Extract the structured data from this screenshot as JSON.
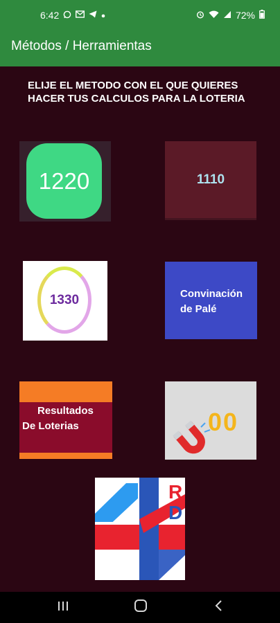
{
  "status_bar": {
    "time": "6:42",
    "left_icons": [
      "whatsapp-icon",
      "gmail-icon",
      "telegram-icon",
      "notification-dot-icon"
    ],
    "right_icons": [
      "alarm-icon",
      "wifi-icon",
      "signal-icon",
      "battery-icon"
    ],
    "battery": "72%"
  },
  "app_bar": {
    "title": "Métodos / Herramientas"
  },
  "instructions": "ELIJE EL METODO CON EL QUE QUIERES HACER TUS CALCULOS PARA LA LOTERIA",
  "tiles": {
    "method_1220": {
      "label": "1220",
      "color": "#3fd884"
    },
    "method_1110": {
      "label": "1110",
      "color": "#5b1a27"
    },
    "method_1330": {
      "label": "1330",
      "color": "#6c2a9e"
    },
    "pale_combination": {
      "line1": "Convinación",
      "line2": "de Palé",
      "color": "#3d49c6"
    },
    "lottery_results": {
      "line1": "Resultados",
      "line2": "De  Loterias",
      "color": "#8a0c2b",
      "accent": "#f57c25"
    },
    "magnet_numbers": {
      "label": "00",
      "icon": "magnet-icon"
    },
    "rd_logo": {
      "letters": "RD",
      "icon": "rd-logo-icon"
    }
  },
  "nav_bar": {
    "buttons": [
      "recent-apps-icon",
      "home-icon",
      "back-icon"
    ]
  },
  "colors": {
    "app_bar": "#2f8a3e",
    "background": "#2b0613"
  }
}
